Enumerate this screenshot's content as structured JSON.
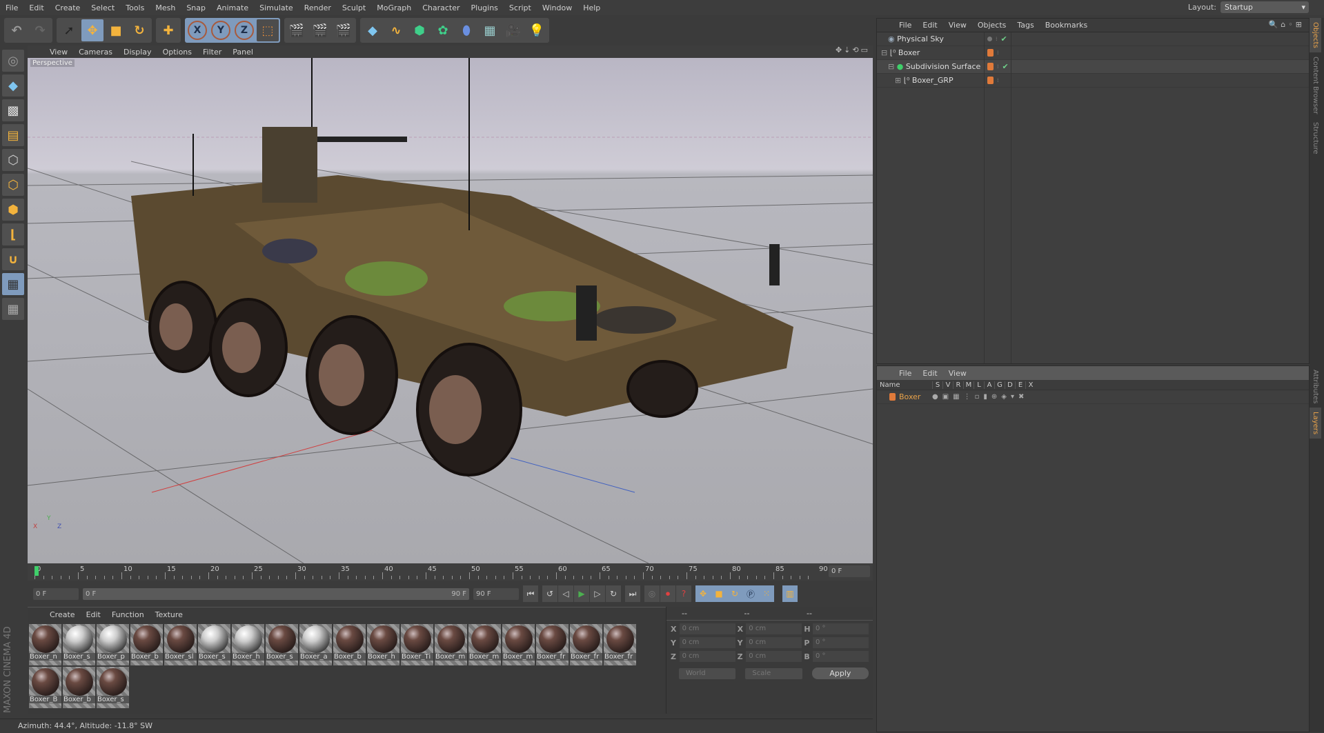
{
  "menubar": [
    "File",
    "Edit",
    "Create",
    "Select",
    "Tools",
    "Mesh",
    "Snap",
    "Animate",
    "Simulate",
    "Render",
    "Sculpt",
    "MoGraph",
    "Character",
    "Plugins",
    "Script",
    "Window",
    "Help"
  ],
  "layout": {
    "label": "Layout:",
    "value": "Startup"
  },
  "toolbar": {
    "axes": [
      "X",
      "Y",
      "Z"
    ]
  },
  "viewport": {
    "menu": [
      "View",
      "Cameras",
      "Display",
      "Options",
      "Filter",
      "Panel"
    ],
    "label": "Perspective",
    "axis_labels": [
      "Y",
      "X",
      "Z"
    ]
  },
  "timeline": {
    "ticks": [
      "0",
      "5",
      "10",
      "15",
      "20",
      "25",
      "30",
      "35",
      "40",
      "45",
      "50",
      "55",
      "60",
      "65",
      "70",
      "75",
      "80",
      "85",
      "90"
    ],
    "current_frame": "0 F",
    "start": "0 F",
    "range_start": "0 F",
    "range_end": "90 F",
    "end": "90 F"
  },
  "materials": {
    "menu": [
      "Create",
      "Edit",
      "Function",
      "Texture"
    ],
    "items": [
      "Boxer_n",
      "Boxer_s",
      "Boxer_p",
      "Boxer_b",
      "Boxer_sl",
      "Boxer_s",
      "Boxer_h",
      "Boxer_s",
      "Boxer_a",
      "Boxer_b",
      "Boxer_h",
      "Boxer_Ti",
      "Boxer_m",
      "Boxer_m",
      "Boxer_m",
      "Boxer_fr",
      "Boxer_fr",
      "Boxer_fr",
      "Boxer_B",
      "Boxer_b",
      "Boxer_s"
    ]
  },
  "coords": {
    "headers": [
      "--",
      "--",
      "--"
    ],
    "pos": [
      {
        "axis": "X",
        "value": "0 cm"
      },
      {
        "axis": "Y",
        "value": "0 cm"
      },
      {
        "axis": "Z",
        "value": "0 cm"
      }
    ],
    "size": [
      {
        "axis": "X",
        "value": "0 cm"
      },
      {
        "axis": "Y",
        "value": "0 cm"
      },
      {
        "axis": "Z",
        "value": "0 cm"
      }
    ],
    "rot": [
      {
        "axis": "H",
        "value": "0 °"
      },
      {
        "axis": "P",
        "value": "0 °"
      },
      {
        "axis": "B",
        "value": "0 °"
      }
    ],
    "mode": "World",
    "type": "Scale",
    "apply": "Apply"
  },
  "brand": "MAXON CINEMA 4D",
  "status": "Azimuth: 44.4°, Altitude: -11.8°  SW",
  "objects": {
    "menu": [
      "File",
      "Edit",
      "View",
      "Objects",
      "Tags",
      "Bookmarks"
    ],
    "items": [
      {
        "name": "Physical Sky",
        "indent": 1
      },
      {
        "name": "Boxer",
        "indent": 0
      },
      {
        "name": "Subdivision Surface",
        "indent": 1
      },
      {
        "name": "Boxer_GRP",
        "indent": 2
      }
    ]
  },
  "layers": {
    "menu": [
      "File",
      "Edit",
      "View"
    ],
    "columns": [
      "Name",
      "S",
      "V",
      "R",
      "M",
      "L",
      "A",
      "G",
      "D",
      "E",
      "X"
    ],
    "items": [
      {
        "name": "Boxer",
        "color": "#e07a3a"
      }
    ]
  },
  "side_tabs": [
    "Objects",
    "Content Browser",
    "Structure",
    "Attributes",
    "Layers"
  ]
}
